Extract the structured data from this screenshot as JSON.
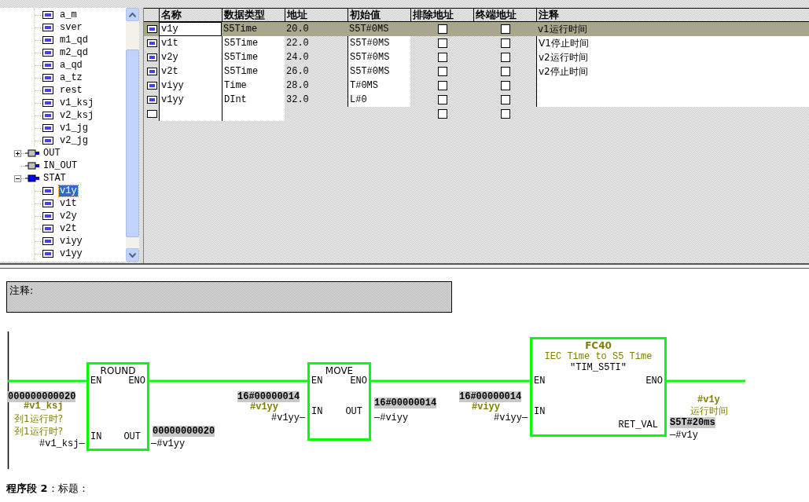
{
  "tree": {
    "items": [
      {
        "children": [
          {
            "kind": "variable",
            "label": "a_m",
            "selected": false
          },
          {
            "kind": "variable",
            "label": "sver",
            "selected": false
          },
          {
            "kind": "variable",
            "label": "m1_qd",
            "selected": false
          },
          {
            "kind": "variable",
            "label": "m2_qd",
            "selected": false
          },
          {
            "kind": "variable",
            "label": "a_qd",
            "selected": false
          },
          {
            "kind": "variable",
            "label": "a_tz",
            "selected": false
          },
          {
            "kind": "variable",
            "label": "rest",
            "selected": false
          },
          {
            "kind": "variable",
            "label": "v1_ksj",
            "selected": false
          },
          {
            "kind": "variable",
            "label": "v2_ksj",
            "selected": false
          },
          {
            "kind": "variable",
            "label": "v1_jg",
            "selected": false
          },
          {
            "kind": "variable",
            "label": "v2_jg",
            "selected": false
          }
        ]
      },
      {
        "kind": "section",
        "label": "OUT",
        "selected": false,
        "expanded": false
      },
      {
        "kind": "section",
        "label": "IN_OUT",
        "selected": false
      },
      {
        "kind": "section",
        "label": "STAT",
        "selected": false,
        "expanded": true,
        "children": [
          {
            "kind": "variable",
            "label": "v1y",
            "selected": true
          },
          {
            "kind": "variable",
            "label": "v1t",
            "selected": false
          },
          {
            "kind": "variable",
            "label": "v2y",
            "selected": false
          },
          {
            "kind": "variable",
            "label": "v2t",
            "selected": false
          },
          {
            "kind": "variable",
            "label": "viyy",
            "selected": false
          },
          {
            "kind": "variable",
            "label": "v1yy",
            "selected": false
          }
        ]
      }
    ]
  },
  "table": {
    "columns": [
      "名称",
      "数据类型",
      "地址",
      "初始值",
      "排除地址",
      "终端地址",
      "注释"
    ],
    "rows": [
      {
        "kind": "variable",
        "selected": true,
        "name": "v1y",
        "data_type": "S5Time",
        "address": "20.0",
        "initial_value": "S5T#0MS",
        "exclude_address": false,
        "terminal_address": false,
        "comment": "v1运行时间"
      },
      {
        "kind": "variable",
        "selected": false,
        "name": "v1t",
        "data_type": "S5Time",
        "address": "22.0",
        "initial_value": "S5T#0MS",
        "exclude_address": false,
        "terminal_address": false,
        "comment": "V1停止时间"
      },
      {
        "kind": "variable",
        "selected": false,
        "name": "v2y",
        "data_type": "S5Time",
        "address": "24.0",
        "initial_value": "S5T#0MS",
        "exclude_address": false,
        "terminal_address": false,
        "comment": "v2运行时间"
      },
      {
        "kind": "variable",
        "selected": false,
        "name": "v2t",
        "data_type": "S5Time",
        "address": "26.0",
        "initial_value": "S5T#0MS",
        "exclude_address": false,
        "terminal_address": false,
        "comment": "v2停止时间"
      },
      {
        "kind": "variable",
        "selected": false,
        "name": "viyy",
        "data_type": "Time",
        "address": "28.0",
        "initial_value": "T#0MS",
        "exclude_address": false,
        "terminal_address": false
      },
      {
        "kind": "variable",
        "selected": false,
        "name": "v1yy",
        "data_type": "DInt",
        "address": "32.0",
        "initial_value": "L#0",
        "exclude_address": false,
        "terminal_address": false
      },
      {
        "kind": "new",
        "selected": false,
        "exclude_address": false,
        "terminal_address": false
      }
    ]
  },
  "network": {
    "comment_label": "注释:",
    "blocks": [
      {
        "title": "ROUND",
        "en": "EN",
        "eno": "ENO",
        "input": "IN",
        "output": "OUT"
      },
      {
        "title": "MOVE",
        "en": "EN",
        "eno": "ENO",
        "input": "IN",
        "output": "OUT"
      },
      {
        "number": "FC40",
        "description": "IEC Time to S5 Time",
        "symbol": "″TIM_S5TI″",
        "en": "EN",
        "eno": "ENO",
        "input": "IN",
        "output": "RET_VAL"
      }
    ],
    "labels": [
      {
        "kind": "value",
        "text": "000000000020"
      },
      {
        "kind": "symbol",
        "text": "#v1_ksj"
      },
      {
        "kind": "comment",
        "text": "刭1运行时?"
      },
      {
        "kind": "comment",
        "text": "刭1运行时?"
      },
      {
        "kind": "operand",
        "text": "#v1_ksj—"
      },
      {
        "kind": "value",
        "text": "00000000020"
      },
      {
        "kind": "operand",
        "text": "—#v1yy"
      },
      {
        "kind": "value",
        "text": "16#00000014"
      },
      {
        "kind": "symbol",
        "text": "#v1yy"
      },
      {
        "kind": "operand",
        "text": "#v1yy—"
      },
      {
        "kind": "value",
        "text": "16#00000014"
      },
      {
        "kind": "operand",
        "text": "—#viyy"
      },
      {
        "kind": "value",
        "text": "16#00000014"
      },
      {
        "kind": "symbol",
        "text": "#viyy"
      },
      {
        "kind": "operand",
        "text": "#viyy—"
      },
      {
        "kind": "symbol",
        "text": "#v1y"
      },
      {
        "kind": "comment",
        "text": "运行时间"
      },
      {
        "kind": "value",
        "text": "S5T#20ms"
      },
      {
        "kind": "operand",
        "text": "—#v1y"
      }
    ]
  },
  "next_network": {
    "title": "**程序段 2**：标题："
  }
}
